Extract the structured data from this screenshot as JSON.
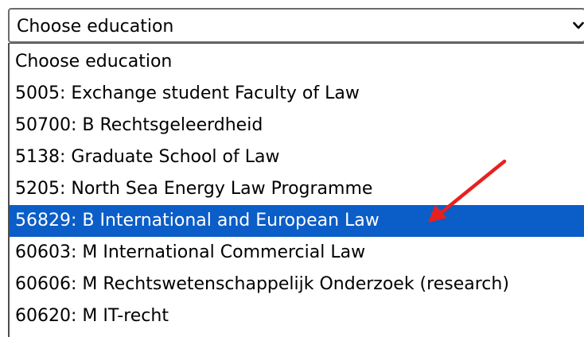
{
  "select": {
    "value": "Choose education",
    "icon": "chevron-down-icon"
  },
  "options": [
    "Choose education",
    "5005: Exchange student Faculty of Law",
    "50700: B Rechtsgeleerdheid",
    "5138: Graduate School of Law",
    "5205: North Sea Energy Law Programme",
    "56829: B International and European Law",
    "60603: M International Commercial Law",
    "60606: M Rechtswetenschappelijk Onderzoek (research)",
    "60620: M IT-recht"
  ],
  "highlighted_index": 5,
  "annotation": {
    "type": "arrow",
    "color": "#e82020"
  },
  "colors": {
    "highlight": "#0b5dc7",
    "highlight_text": "#ffffff"
  }
}
